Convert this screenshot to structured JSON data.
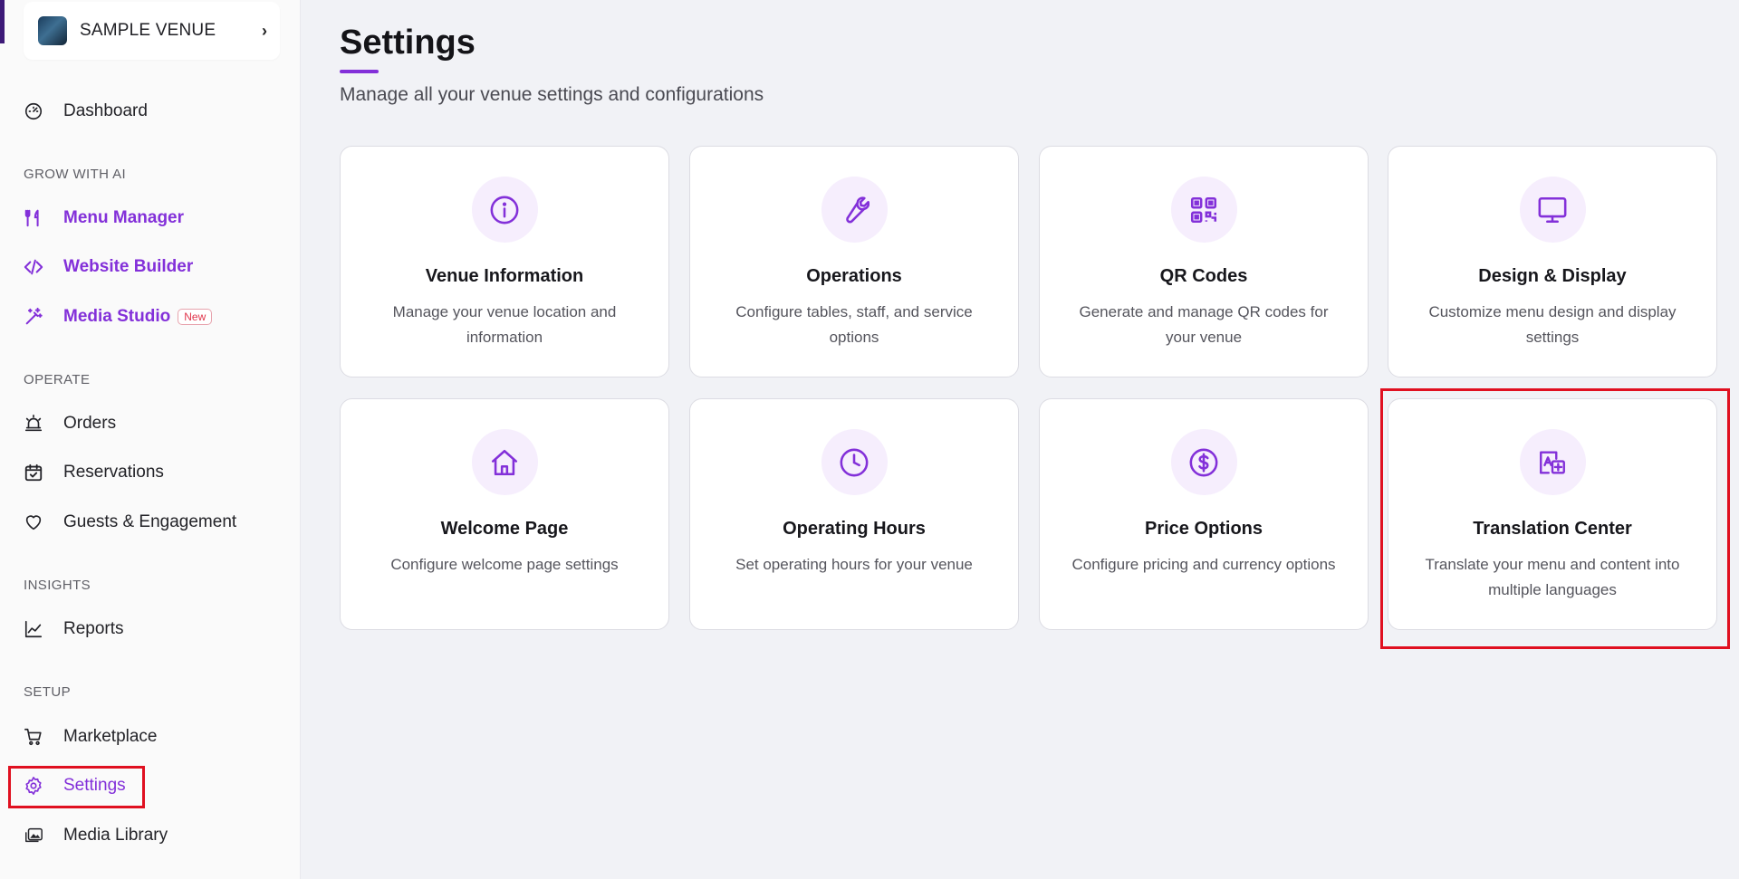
{
  "venue": {
    "name": "SAMPLE VENUE",
    "chevron": "›"
  },
  "sidebar": {
    "dashboard": "Dashboard",
    "sections": {
      "grow": "GROW WITH AI",
      "operate": "OPERATE",
      "insights": "INSIGHTS",
      "setup": "SETUP"
    },
    "grow_items": [
      {
        "label": "Menu Manager",
        "icon": "utensils-icon"
      },
      {
        "label": "Website Builder",
        "icon": "code-icon"
      },
      {
        "label": "Media Studio",
        "icon": "magic-wand-icon",
        "badge": "New"
      }
    ],
    "operate_items": [
      {
        "label": "Orders",
        "icon": "alarm-bell-icon"
      },
      {
        "label": "Reservations",
        "icon": "calendar-check-icon"
      },
      {
        "label": "Guests & Engagement",
        "icon": "heart-icon"
      }
    ],
    "insights_items": [
      {
        "label": "Reports",
        "icon": "line-chart-icon"
      }
    ],
    "setup_items": [
      {
        "label": "Marketplace",
        "icon": "cart-icon"
      },
      {
        "label": "Settings",
        "icon": "gear-icon",
        "active": true
      },
      {
        "label": "Media Library",
        "icon": "images-icon"
      }
    ]
  },
  "main": {
    "title": "Settings",
    "subtitle": "Manage all your venue settings and configurations",
    "cards": [
      {
        "title": "Venue Information",
        "desc": "Manage your venue location and information",
        "icon": "info-icon"
      },
      {
        "title": "Operations",
        "desc": "Configure tables, staff, and service options",
        "icon": "wrench-icon"
      },
      {
        "title": "QR Codes",
        "desc": "Generate and manage QR codes for your venue",
        "icon": "qr-code-icon"
      },
      {
        "title": "Design & Display",
        "desc": "Customize menu design and display settings",
        "icon": "monitor-icon"
      },
      {
        "title": "Welcome Page",
        "desc": "Configure welcome page settings",
        "icon": "home-icon"
      },
      {
        "title": "Operating Hours",
        "desc": "Set operating hours for your venue",
        "icon": "clock-icon"
      },
      {
        "title": "Price Options",
        "desc": "Configure pricing and currency options",
        "icon": "dollar-circle-icon"
      },
      {
        "title": "Translation Center",
        "desc": "Translate your menu and content into multiple languages",
        "icon": "translate-icon"
      }
    ]
  },
  "colors": {
    "accent": "#8330d9",
    "highlight": "#e01020",
    "icon_bg": "#f6eefd"
  }
}
